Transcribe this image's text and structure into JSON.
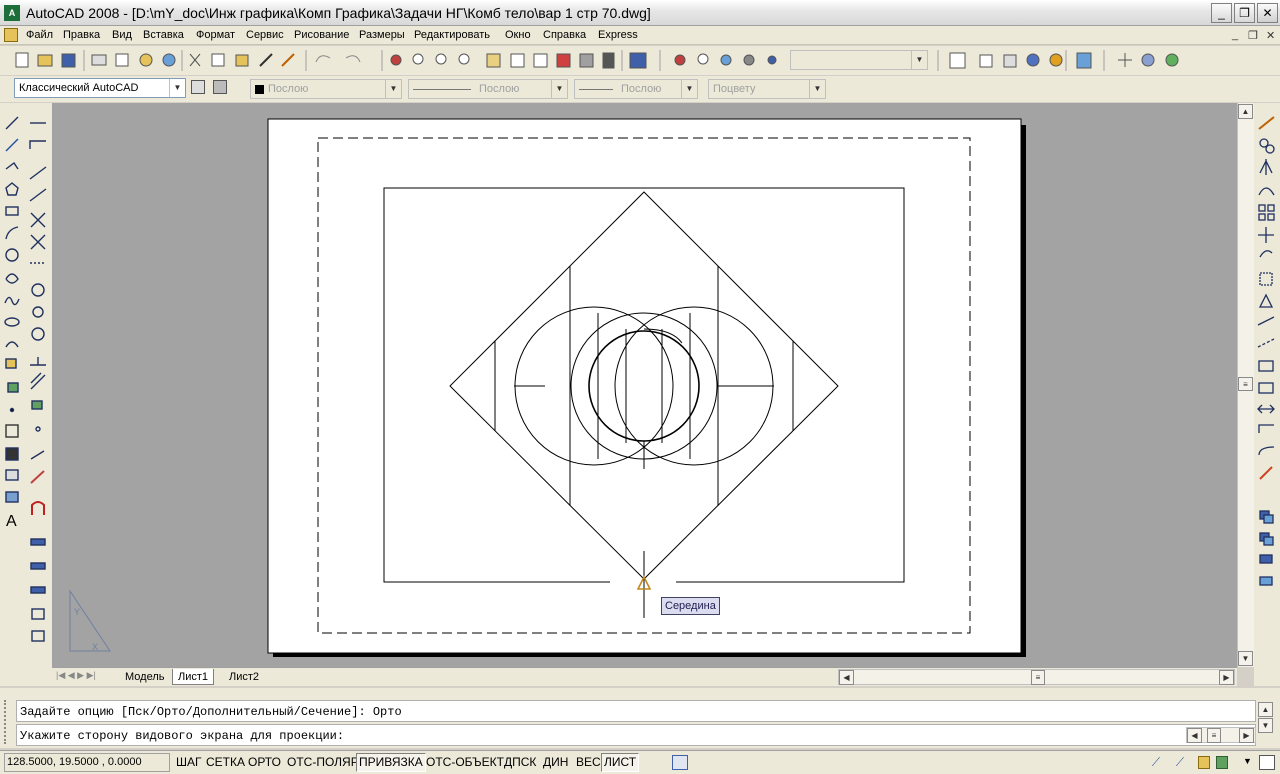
{
  "window": {
    "title": "AutoCAD 2008 - [D:\\mY_doc\\Инж графика\\Комп Графика\\Задачи НГ\\Комб тело\\вар 1 стр 70.dwg]",
    "app_icon": "autocad-logo-icon",
    "min": "_",
    "max": "❐",
    "close": "✕"
  },
  "menu": {
    "items": [
      "Файл",
      "Правка",
      "Вид",
      "Вставка",
      "Формат",
      "Сервис",
      "Рисование",
      "Размеры",
      "Редактировать",
      "Окно",
      "Справка",
      "Express"
    ],
    "mdi_controls": [
      "_",
      "❐",
      "✕"
    ]
  },
  "properties_bar": {
    "workspace": "Классический AutoCAD",
    "color": "Послою",
    "linetype": "Послою",
    "lineweight": "Послою",
    "plotstyle": "Поцвету"
  },
  "layout_tabs": {
    "tabs": [
      "Модель",
      "Лист1",
      "Лист2"
    ],
    "active": "Лист1"
  },
  "tooltip": {
    "snap_label": "Середина"
  },
  "command": {
    "line1": "Задайте опцию [Пск/Орто/Дополнительный/Сечение]: Орто",
    "line2": "Укажите сторону видового экрана для проекции:"
  },
  "status": {
    "coords": "128.5000, 19.5000 , 0.0000",
    "buttons": [
      {
        "label": "ШАГ",
        "on": false
      },
      {
        "label": "СЕТКА",
        "on": false
      },
      {
        "label": "ОРТО",
        "on": false
      },
      {
        "label": "ОТС-ПОЛЯР",
        "on": false
      },
      {
        "label": "ПРИВЯЗКА",
        "on": true
      },
      {
        "label": "ОТС-ОБЪЕКТ",
        "on": false
      },
      {
        "label": "ДПСК",
        "on": false
      },
      {
        "label": "ДИН",
        "on": false
      },
      {
        "label": "ВЕС",
        "on": false
      },
      {
        "label": "ЛИСТ",
        "on": true
      }
    ]
  },
  "colors": {
    "canvas_bg": "#a3a3a3",
    "paper": "#ffffff",
    "ui_bg": "#ece9d8",
    "snap_marker": "#c08a20",
    "tooltip_bg": "#dcdcf0"
  }
}
